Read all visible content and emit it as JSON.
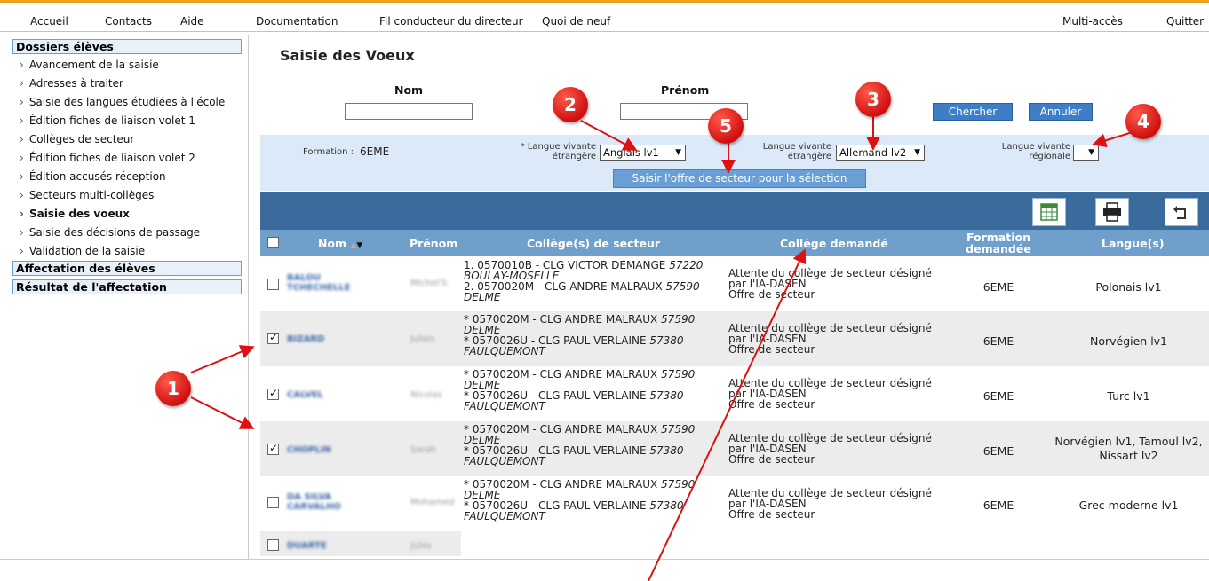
{
  "topnav": {
    "items": [
      "Accueil",
      "Contacts",
      "Aide",
      "Documentation",
      "Fil conducteur du directeur",
      "Quoi de neuf"
    ],
    "right": [
      "Multi-accès",
      "Quitter"
    ]
  },
  "sidebar": {
    "sections": [
      "Dossiers élèves",
      "Affectation des élèves",
      "Résultat de l'affectation"
    ],
    "items": [
      "Avancement de la saisie",
      "Adresses à traiter",
      "Saisie des langues étudiées à l'école",
      "Édition fiches de liaison volet 1",
      "Collèges de secteur",
      "Édition fiches de liaison volet 2",
      "Édition accusés réception",
      "Secteurs multi-collèges",
      "Saisie des voeux",
      "Saisie des décisions de passage",
      "Validation de la saisie"
    ]
  },
  "page": {
    "title": "Saisie des Voeux"
  },
  "search": {
    "nom_label": "Nom",
    "prenom_label": "Prénom",
    "nom_value": "",
    "prenom_value": "",
    "search_button": "Chercher",
    "cancel_button": "Annuler"
  },
  "filters": {
    "formation_label": "Formation :",
    "formation_value": "6EME",
    "lv_etr1_label_1": "* Langue vivante",
    "lv_etr1_label_2": "étrangère",
    "lv_etr1_value": "Anglais lv1",
    "lv_etr2_label_1": "Langue vivante",
    "lv_etr2_label_2": "étrangère",
    "lv_etr2_value": "Allemand lv2",
    "lv_reg_label_1": "Langue vivante",
    "lv_reg_label_2": "régionale",
    "lv_reg_value": "",
    "apply_button": "Saisir l'offre de secteur pour la sélection"
  },
  "table": {
    "headers": [
      "Nom",
      "Prénom",
      "Collège(s) de secteur",
      "Collège demandé",
      "Formation",
      "demandée",
      "Langue(s)"
    ],
    "rows": [
      {
        "nom1": "BALOU",
        "nom2": "TCHECHELLE",
        "prenom": "Michel'S",
        "checked": false,
        "c1a": "1. 0570010B - CLG VICTOR DEMANGE ",
        "c1b": "57220",
        "c2": "BOULAY-MOSELLE",
        "c3a": "2. 0570020M - CLG ANDRE MALRAUX ",
        "c3b": "57590",
        "c4": "DELME",
        "d1": "Attente du collège de secteur désigné",
        "d2": "par l'IA-DASEN",
        "d3": "Offre de secteur",
        "formation": "6EME",
        "lang1": "Polonais lv1",
        "lang2": ""
      },
      {
        "nom1": "BIZARD",
        "nom2": "",
        "prenom": "Julien",
        "checked": true,
        "c1a": "* 0570020M - CLG ANDRE MALRAUX ",
        "c1b": "57590",
        "c2": "DELME",
        "c3a": "* 0570026U - CLG PAUL VERLAINE ",
        "c3b": "57380",
        "c4": "FAULQUEMONT",
        "d1": "Attente du collège de secteur désigné",
        "d2": "par l'IA-DASEN",
        "d3": "Offre de secteur",
        "formation": "6EME",
        "lang1": "Norvégien lv1",
        "lang2": ""
      },
      {
        "nom1": "CALVEL",
        "nom2": "",
        "prenom": "Nicolas",
        "checked": true,
        "c1a": "* 0570020M - CLG ANDRE MALRAUX ",
        "c1b": "57590",
        "c2": "DELME",
        "c3a": "* 0570026U - CLG PAUL VERLAINE ",
        "c3b": "57380",
        "c4": "FAULQUEMONT",
        "d1": "Attente du collège de secteur désigné",
        "d2": "par l'IA-DASEN",
        "d3": "Offre de secteur",
        "formation": "6EME",
        "lang1": "Turc lv1",
        "lang2": ""
      },
      {
        "nom1": "CHOPLIN",
        "nom2": "",
        "prenom": "Sarah",
        "checked": true,
        "c1a": "* 0570020M - CLG ANDRE MALRAUX ",
        "c1b": "57590",
        "c2": "DELME",
        "c3a": "* 0570026U - CLG PAUL VERLAINE ",
        "c3b": "57380",
        "c4": "FAULQUEMONT",
        "d1": "Attente du collège de secteur désigné",
        "d2": "par l'IA-DASEN",
        "d3": "Offre de secteur",
        "formation": "6EME",
        "lang1": "Norvégien lv1, Tamoul lv2,",
        "lang2": "Nissart lv2"
      },
      {
        "nom1": "DA SILVA",
        "nom2": "CARVALHO",
        "prenom": "Mohamed",
        "checked": false,
        "c1a": "* 0570020M - CLG ANDRE MALRAUX ",
        "c1b": "57590",
        "c2": "DELME",
        "c3a": "* 0570026U - CLG PAUL VERLAINE ",
        "c3b": "57380",
        "c4": "FAULQUEMONT",
        "d1": "Attente du collège de secteur désigné",
        "d2": "par l'IA-DASEN",
        "d3": "Offre de secteur",
        "formation": "6EME",
        "lang1": "Grec moderne lv1",
        "lang2": ""
      },
      {
        "nom1": "DUARTE",
        "nom2": "",
        "prenom": "Jules",
        "checked": false
      }
    ]
  },
  "annotations": [
    "1",
    "2",
    "3",
    "4",
    "5"
  ],
  "colors": {
    "accent": "#f0a020",
    "header": "#6fa0cc",
    "toolbar": "#3b6a9c",
    "band": "#dbe9f8",
    "marker": "#e01010"
  }
}
